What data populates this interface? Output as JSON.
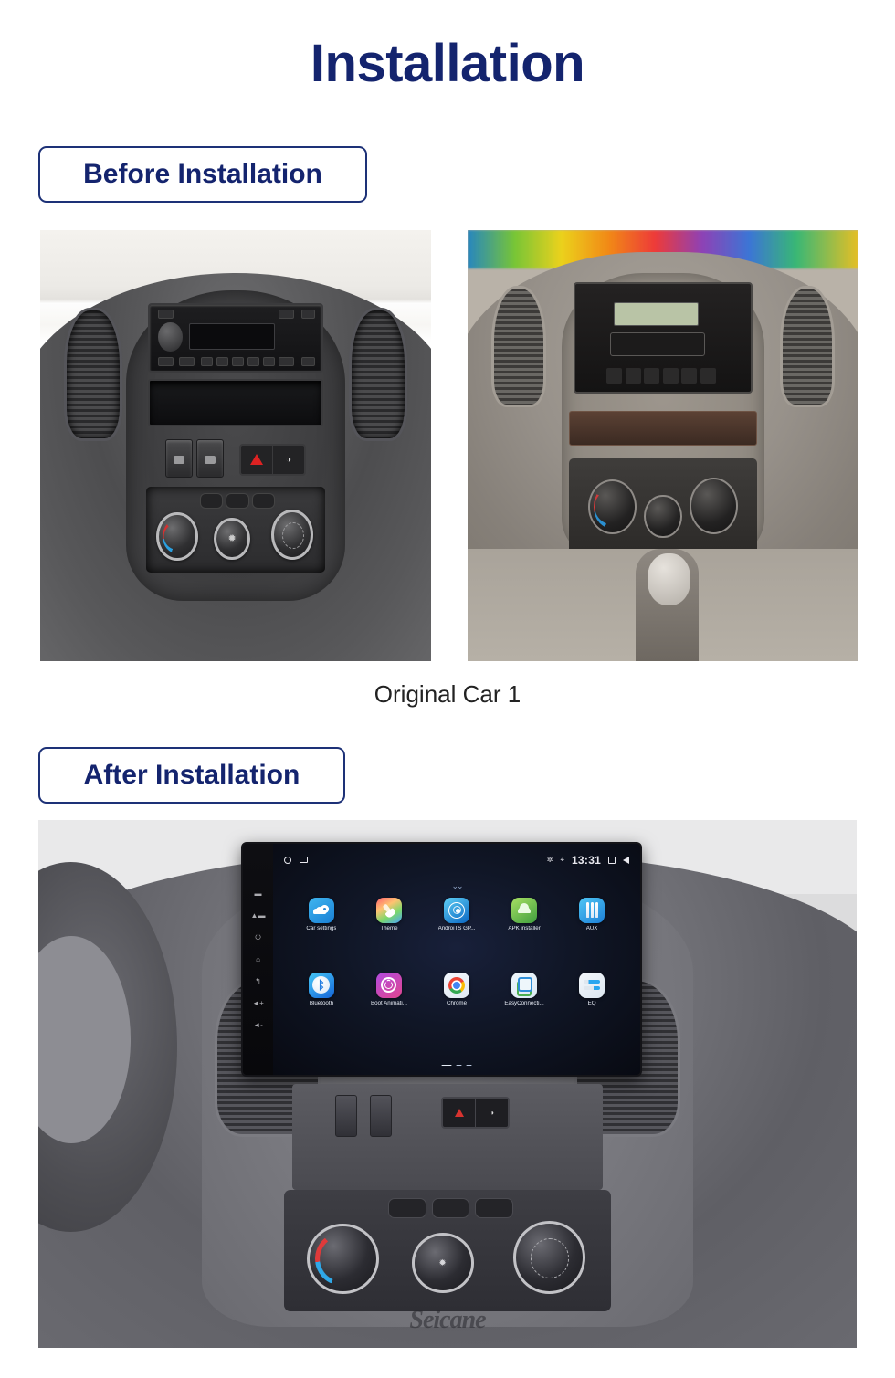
{
  "page": {
    "title": "Installation",
    "title_color": "#14246e",
    "accent_border": "#1d3177",
    "background": "#ffffff"
  },
  "sections": {
    "before": {
      "chip_label": "Before Installation",
      "caption": "Original Car  1",
      "photos": [
        {
          "alt_name": "original-dashboard-front-view"
        },
        {
          "alt_name": "original-dashboard-angled-view"
        }
      ]
    },
    "after": {
      "chip_label": "After Installation",
      "photo": {
        "alt_name": "installed-android-head-unit-dashboard"
      },
      "watermark": "Seicane"
    }
  },
  "head_unit": {
    "status_bar": {
      "left_icons": [
        "circle-icon",
        "image-icon"
      ],
      "bluetooth_icon": "bluetooth-icon",
      "location_icon": "location-icon",
      "clock": "13:31",
      "recents_icon": "recents-icon",
      "back_icon": "back-icon"
    },
    "pull_handle": "chevron-down-icon",
    "side_buttons": [
      "mute-icon",
      "eject-icon",
      "power-icon",
      "home-icon",
      "back-icon",
      "volume-up-icon",
      "volume-down-icon"
    ],
    "apps": [
      {
        "label": "Car settings",
        "icon": "car-settings-icon"
      },
      {
        "label": "Theme",
        "icon": "paint-brush-icon"
      },
      {
        "label": "AndroiTS GP...",
        "icon": "gps-radar-icon"
      },
      {
        "label": "APK installer",
        "icon": "android-robot-icon"
      },
      {
        "label": "AUX",
        "icon": "aux-cable-icon"
      },
      {
        "label": "Bluetooth",
        "icon": "bluetooth-icon"
      },
      {
        "label": "Boot Animati...",
        "icon": "power-ring-icon"
      },
      {
        "label": "Chrome",
        "icon": "chrome-icon"
      },
      {
        "label": "EasyConnecti...",
        "icon": "easy-connection-icon"
      },
      {
        "label": "EQ",
        "icon": "equalizer-icon"
      }
    ],
    "pagination": {
      "pages": 3,
      "current": 1
    }
  },
  "controls": {
    "hazard_icon": "hazard-triangle-icon",
    "rear_fog_icon": "rear-fog-light-icon",
    "window_switches": 2,
    "hvac_knobs": [
      "temperature-knob",
      "fan-speed-knob",
      "air-mode-knob"
    ],
    "hvac_buttons": [
      "defrost-button",
      "rear-defrost-button",
      "ac-button"
    ]
  }
}
